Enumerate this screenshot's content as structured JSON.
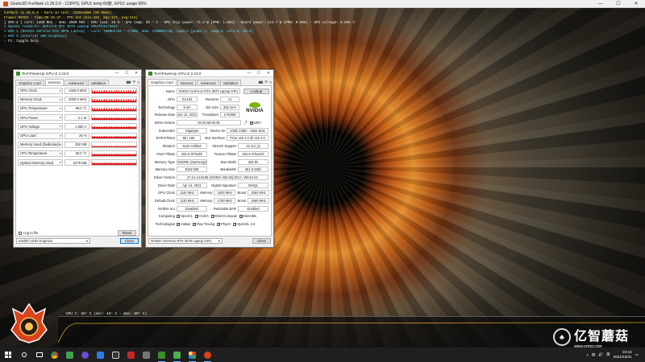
{
  "furmark": {
    "window_title": "Geeks3D FurMark v1.26.0.0 - 113FPS, GPU1 temp:69度, GPU1 usage:96%",
    "overlay": [
      {
        "text": "FurMark v1.26.0.0 - Burn-in test, 1920x1080 (0X MSAA)",
        "color": "yellow"
      },
      {
        "text": "Frames:90783 - time:00:15:47 - FPS:113 (min:102, max:127, avg:114)",
        "color": "yellow"
      },
      {
        "text": "[ GPU-Z ] core: 1450 MHz - mem: 2000 MHz - GPU load: 25 % - GPU temp: 69 ° C - GPU chip power: 72.2 W (PPW: 1.566) - Board power: 114.7 W (PPW: 0.985) - GPU voltage: 0.856 V",
        "color": "white"
      },
      {
        "text": "> OpenGL renderer: GeForce RTX 3070 Laptop GPU/PCIe/SSE2",
        "color": "cyan"
      },
      {
        "text": "> GPU 1 (NVIDIA GeForce RTX 3070 Laptop) - core: 780MHz/69 ° C/96%, mem: 7200MHz/3%, limits:[power:1, temp:0, volt:0, OV:0]",
        "color": "cyan"
      },
      {
        "text": "> GPU 2 (Intel(R) UHD Graphics)",
        "color": "cyan"
      },
      {
        "text": "- F1: toggle help",
        "color": "white"
      }
    ],
    "graph_label": "GPU 1: 69° C (min: 48° C - max: 69° C)"
  },
  "gpuz_sensors": {
    "title": "TechPowerUp GPU-Z 2.43.0",
    "tabs": [
      "Graphics Card",
      "Sensors",
      "Advanced",
      "Validation"
    ],
    "active_tab": 1,
    "sensors": [
      {
        "name": "GPU Clock",
        "value": "1450.0 MHz",
        "level": 0.6
      },
      {
        "name": "Memory Clock",
        "value": "2000.0 MHz",
        "level": 0.55
      },
      {
        "name": "GPU Temperature",
        "value": "69.0 °C",
        "level": 0.65
      },
      {
        "name": "GPU Power",
        "value": "2.1 W",
        "level": 0.5
      },
      {
        "name": "GPU Voltage",
        "value": "1.060 V",
        "level": 0.6
      },
      {
        "name": "GPU Load",
        "value": "25 %",
        "level": 0.45
      },
      {
        "name": "Memory Used (Dedicated)",
        "value": "352 MB",
        "level": 0.3
      },
      {
        "name": "CPU Temperature",
        "value": "60.0 °C",
        "level": 0.55
      },
      {
        "name": "System Memory Used",
        "value": "5279 MB",
        "level": 0.5
      }
    ],
    "log_to_file": "Log to file",
    "reset": "Reset",
    "device_select": "Intel(R) UHD Graphics",
    "close": "Close"
  },
  "gpuz_card": {
    "title": "TechPowerUp GPU-Z 2.43.0",
    "tabs": [
      "Graphics Card",
      "Sensors",
      "Advanced",
      "Validation"
    ],
    "active_tab": 0,
    "name_label": "Name",
    "name": "NVIDIA GeForce RTX 3070 Laptop GPU",
    "lookup": "Lookup",
    "gpu_label": "GPU",
    "gpu": "GA104",
    "revision_label": "Revision",
    "revision": "A1",
    "technology_label": "Technology",
    "technology": "8 nm",
    "die_size_label": "Die Size",
    "die_size": "392 mm²",
    "release_label": "Release Date",
    "release": "Jan 12, 2021",
    "transistors_label": "Transistors",
    "transistors": "17400M",
    "bios_label": "BIOS Version",
    "bios": "94.04.55.00.35",
    "uefi": "UEFI",
    "subvendor_label": "Subvendor",
    "subvendor": "Gigabyte",
    "device_id_label": "Device ID",
    "device_id": "10DE 249D - 1458 1531",
    "rops_label": "ROPs/TMUs",
    "rops": "96 / 160",
    "bus_label": "Bus Interface",
    "bus": "PCIe x16 4.0 @ x16 4.0",
    "shaders_label": "Shaders",
    "shaders": "5120 Unified",
    "directx_label": "DirectX Support",
    "directx": "12 (12_2)",
    "pixel_label": "Pixel Fillrate",
    "pixel": "152.9 GPixel/s",
    "texture_label": "Texture Fillrate",
    "texture": "254.9 GTexel/s",
    "memtype_label": "Memory Type",
    "memtype": "GDDR6 (Samsung)",
    "buswidth_label": "Bus Width",
    "buswidth": "256 bit",
    "memsize_label": "Memory Size",
    "memsize": "8192 MB",
    "bandwidth_label": "Bandwidth",
    "bandwidth": "461.8 GB/s",
    "driver_label": "Driver Version",
    "driver": "27.21.14.6236 (NVIDIA 462.36) DCH / Win10 64",
    "driver_date_label": "Driver Date",
    "driver_date": "Apr 14, 2021",
    "digital_label": "Digital Signature",
    "digital": "WHQL",
    "gpuclock_label": "GPU Clock",
    "gpuclock": "1140 MHz",
    "memory_label": "Memory",
    "memory1": "1803 MHz",
    "boost_label": "Boost",
    "boost1": "1593 MHz",
    "defclock_label": "Default Clock",
    "defclock": "1110 MHz",
    "memory2": "1750 MHz",
    "boost2": "1560 MHz",
    "sli_label": "NVIDIA SLI",
    "sli": "Disabled",
    "rebar_label": "Resizable BAR",
    "rebar": "Enabled",
    "computing_label": "Computing",
    "computing": [
      "OpenCL",
      "CUDA",
      "DirectCompute",
      "DirectML"
    ],
    "technologies_label": "Technologies",
    "technologies": [
      "Vulkan",
      "Ray Tracing",
      "PhysX",
      "OpenGL 4.6"
    ],
    "device_select": "NVIDIA GeForce RTX 3070 Laptop GPU",
    "close": "Close"
  },
  "watermark": {
    "cn": "亿智蘑菇",
    "url": "www.yzmg.com"
  },
  "taskbar": {
    "time": "22:16",
    "date": "2021/10/31",
    "lang": "英"
  },
  "colors": {
    "sensor_red": "#e01a1a",
    "nvidia_green": "#76b900",
    "overlay_yellow": "#f5e64a",
    "overlay_cyan": "#5fe0ff",
    "graph_line": "#d4a02a"
  }
}
